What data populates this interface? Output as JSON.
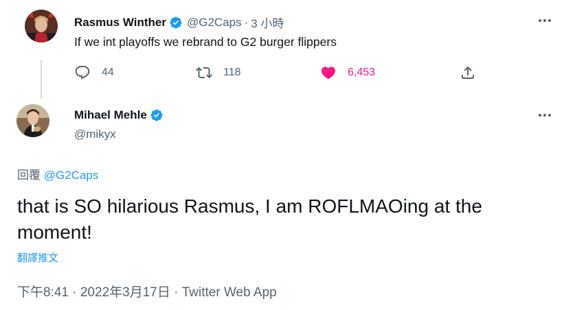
{
  "reply_context": {
    "author_name": "Rasmus Winther",
    "author_handle": "@G2Caps",
    "separator": "·",
    "time": "3 小時",
    "text": "If we int playoffs we rebrand to G2 burger flippers",
    "stats": {
      "replies": "44",
      "retweets": "118",
      "likes": "6,453"
    }
  },
  "main_tweet": {
    "author_name": "Mihael Mehle",
    "author_handle": "@mikyx",
    "replying_prefix": "回覆",
    "replying_to": "@G2Caps",
    "text": "that is SO hilarious Rasmus, I am ROFLMAOing at the moment!",
    "translate_label": "翻譯推文",
    "timestamp": "下午8:41 · 2022年3月17日 · Twitter Web App"
  },
  "colors": {
    "verified": "#1d9bf0",
    "like_active": "#f91880",
    "secondary_text": "#536471",
    "link": "#1d9bf0"
  },
  "icons": {
    "verified": "verified-badge-icon",
    "more": "more-horizontal-icon",
    "reply": "reply-bubble-icon",
    "retweet": "retweet-icon",
    "like": "heart-icon",
    "share": "share-upload-icon"
  }
}
